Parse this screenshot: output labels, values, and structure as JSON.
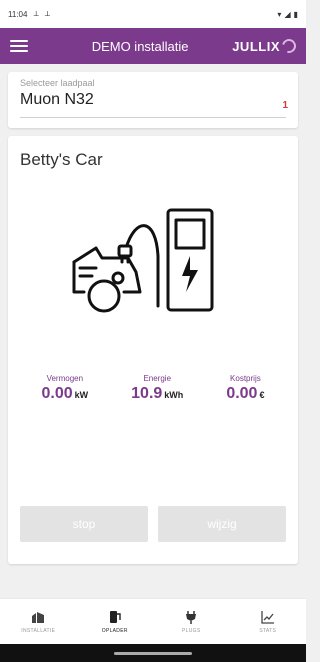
{
  "status_bar": {
    "time": "11:04",
    "icons_left": [
      "signal-icon",
      "signal-icon"
    ],
    "icons_right": [
      "wifi-icon",
      "cell-icon",
      "battery-icon"
    ]
  },
  "app_bar": {
    "title": "DEMO installatie",
    "brand": "JULLIX"
  },
  "selector": {
    "label": "Selecteer laadpaal",
    "value": "Muon N32",
    "count": "1"
  },
  "car": {
    "name": "Betty's Car"
  },
  "stats": [
    {
      "label": "Vermogen",
      "value": "0.00",
      "unit": "kW"
    },
    {
      "label": "Energie",
      "value": "10.9",
      "unit": "kWh"
    },
    {
      "label": "Kostprijs",
      "value": "0.00",
      "unit": "€"
    }
  ],
  "buttons": {
    "stop": "stop",
    "edit": "wijzig"
  },
  "nav": [
    {
      "label": "INSTALLATIE",
      "icon": "installation-icon"
    },
    {
      "label": "OPLADER",
      "icon": "charger-icon"
    },
    {
      "label": "PLUGS",
      "icon": "plug-icon"
    },
    {
      "label": "STATS",
      "icon": "chart-icon"
    }
  ],
  "colors": {
    "primary": "#7b3a8c",
    "badge": "#d23a3a",
    "disabled_button": "#e3e3e3"
  }
}
